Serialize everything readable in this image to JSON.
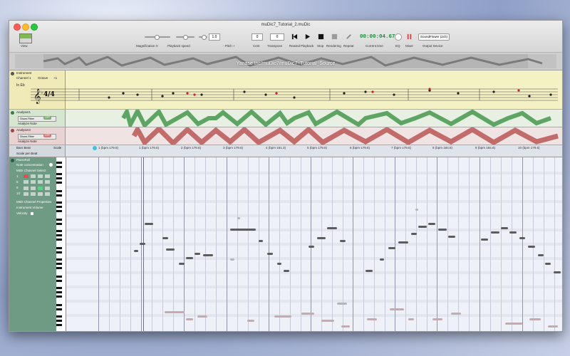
{
  "window": {
    "title": "muDic7_Tutorial_2.muDic",
    "overview_title": "Yanase Inc/muDic7/muDic7_Tutorial_Source"
  },
  "toolbar": {
    "view_label": "View",
    "magnification_label": "Magnification X",
    "playback_speed_label": "Playback speed",
    "pitch_label": "- Pitch +",
    "pitch_value": "1.0",
    "cent_label": "Cent",
    "cent_value": "0",
    "transpose_label": "Transpose",
    "transpose_value": "0",
    "rewind_label": "Rewind",
    "playback_label": "Playback",
    "stop_label": "Stop",
    "rendering_label": "Rendering",
    "repeat_label": "Repeat",
    "time_value": "00:00:04.673",
    "current_time_label": "Current time",
    "eq_label": "EQ",
    "mixer_label": "Mixer",
    "output_device_value": "SoundFlower (2ch)",
    "output_device_label": "Output Device"
  },
  "score": {
    "instrument_label": "Instrument",
    "channel_label": "Channel",
    "channel_value": "1",
    "octave_label": "Octave",
    "octave_value": "+1",
    "key_label": "In Eb",
    "time_signature": "4/4"
  },
  "analyser1": {
    "label": "Analyser1",
    "show_filter": "Show Filter",
    "analyze_note": "Analyze Note",
    "toggle": "OFF",
    "color": "#5ea564"
  },
  "analyser2": {
    "label": "Analyser2",
    "show_filter": "Show Filter",
    "analyze_note": "Analyze Note",
    "toggle": "OFF",
    "color": "#c26b6b"
  },
  "ruler": {
    "side_label": "Bars Beat",
    "scale_label": "Scale",
    "scale_per_beat": "Scale per Beat",
    "bars": [
      "1 (bpm 179.6)",
      "1 (bpm 179.6)",
      "2 (bpm 179.6)",
      "3 (bpm 179.6)",
      "4 (bpm 181.3)",
      "5 (bpm 179.6)",
      "6 (bpm 179.6)",
      "7 (bpm 179.6)",
      "8 (bpm 184.8)",
      "9 (bpm 184.8)",
      "10 (bpm 179.6)"
    ]
  },
  "piano": {
    "pianoroll_label": "PianoRoll",
    "note_concentration": "Note concentration",
    "midi_channel_select": "MIDI Channel Select",
    "midi_channel_properties": "MIDI Channel Properties",
    "instrument_volume": "Instrument Volume",
    "velocity": "Velocity",
    "channel_rows": [
      "1",
      "5",
      "9",
      "13"
    ]
  }
}
